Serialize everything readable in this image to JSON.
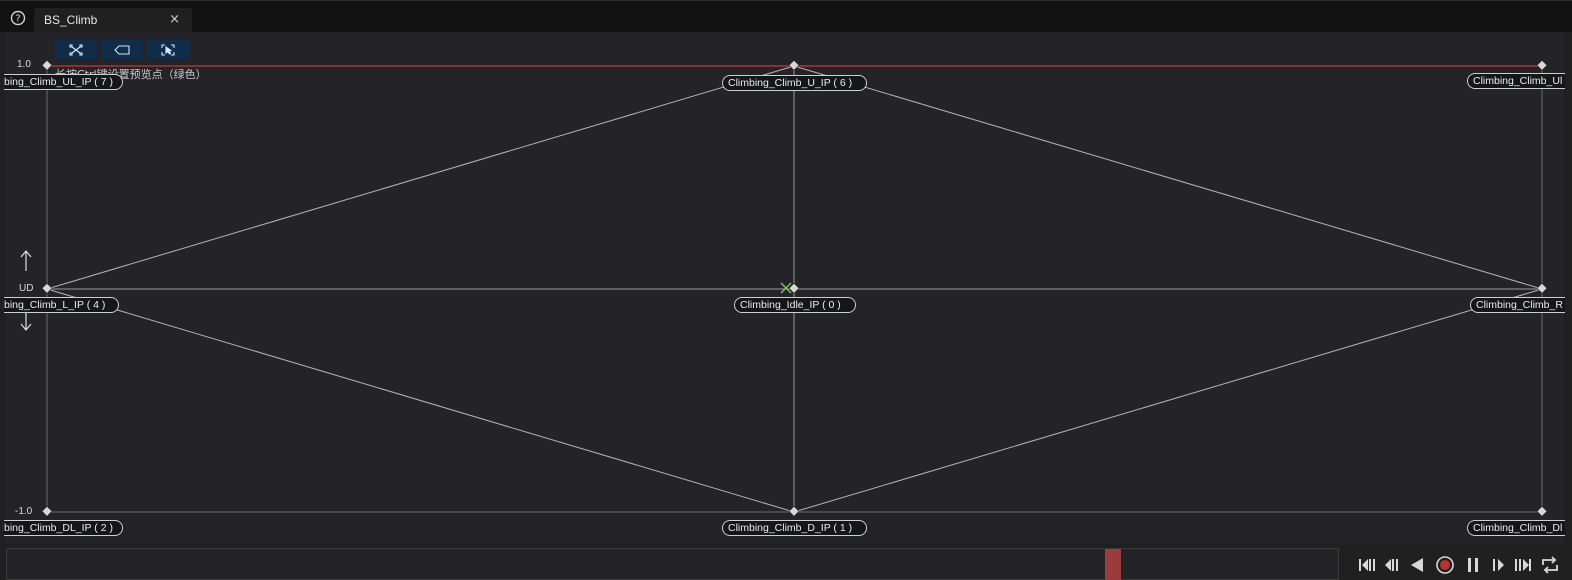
{
  "tab": {
    "title": "BS_Climb",
    "close": "×"
  },
  "hint": "长按Ctrl键设置预览点（绿色）",
  "axis": {
    "y_max": "1.0",
    "y_mid": "UD",
    "y_min": "-1.0"
  },
  "samples": [
    {
      "label": "bing_Climb_UL_IP ( 7 )"
    },
    {
      "label": "Climbing_Climb_U_IP ( 6 )"
    },
    {
      "label": "Climbing_Climb_Ul"
    },
    {
      "label": "bing_Climb_L_IP ( 4 )"
    },
    {
      "label": "Climbing_Idle_IP ( 0 )"
    },
    {
      "label": "Climbing_Climb_R"
    },
    {
      "label": "bing_Climb_DL_IP ( 2 )"
    },
    {
      "label": "Climbing_Climb_D_IP ( 1 )"
    },
    {
      "label": "Climbing_Climb_Dl"
    }
  ],
  "colors": {
    "accent": "#0f2c4a",
    "limit_line": "#c0392b",
    "scrub": "#9b3b3b",
    "record": "#b83232"
  }
}
